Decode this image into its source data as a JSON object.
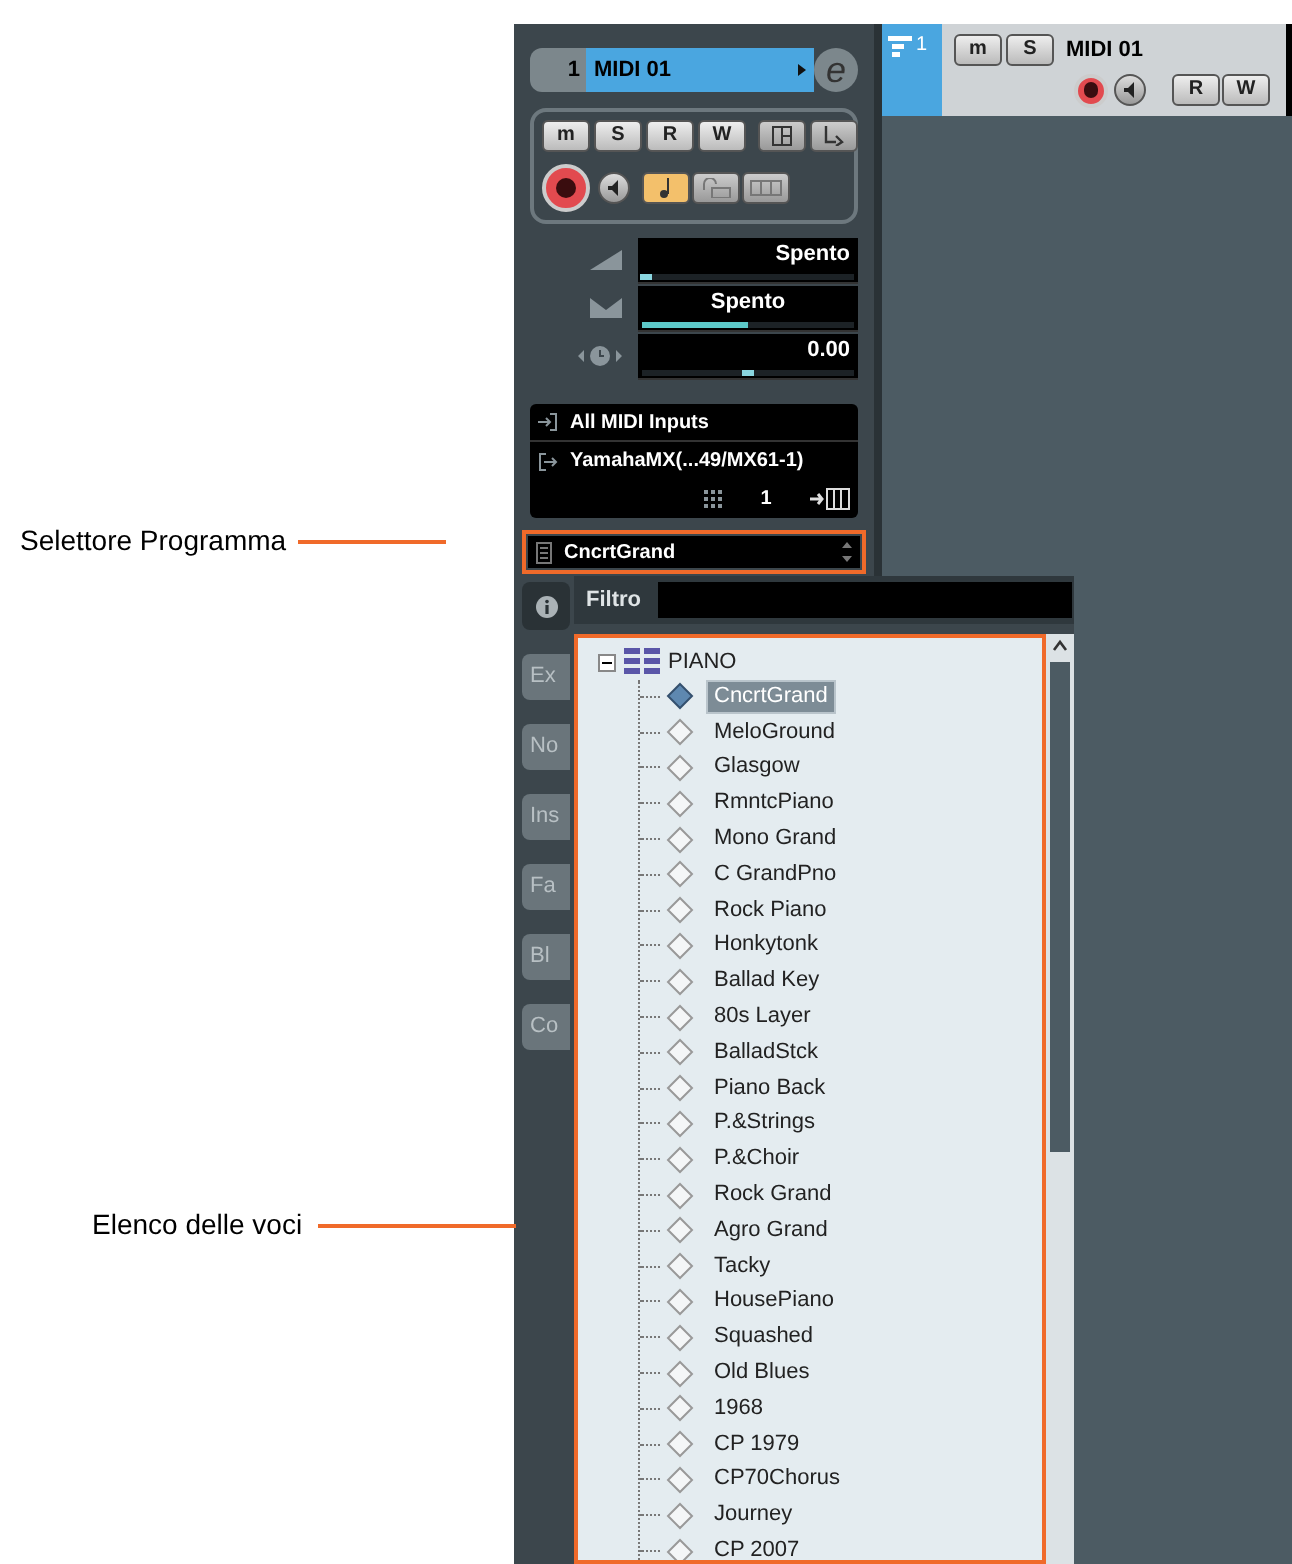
{
  "callouts": [
    {
      "label": "Selettore Programma"
    },
    {
      "label": "Elenco delle voci"
    }
  ],
  "inspector": {
    "track_number": "1",
    "track_name": "MIDI 01",
    "edit_glyph": "e",
    "buttons": [
      {
        "label": "m",
        "kind": "text",
        "on": false
      },
      {
        "label": "S",
        "kind": "text",
        "on": false
      },
      {
        "label": "R",
        "kind": "text",
        "on": false
      },
      {
        "label": "W",
        "kind": "text",
        "on": false
      },
      {
        "kind": "layout",
        "on": false
      },
      {
        "kind": "output",
        "on": false
      }
    ],
    "toggles": [
      {
        "kind": "note",
        "on": true
      },
      {
        "kind": "lock",
        "on": false
      },
      {
        "kind": "grid",
        "on": false
      }
    ],
    "record_armed": true,
    "faders": [
      {
        "kind": "marker",
        "reading": "Spento",
        "level": 0.02
      },
      {
        "kind": "fill",
        "reading": "Spento",
        "level": 0.5
      },
      {
        "kind": "marker",
        "reading": "0.00",
        "level": 0.5
      }
    ],
    "input": "All MIDI Inputs",
    "output": "YamahaMX(...49/MX61-1)",
    "channel": "1",
    "side_tabs": [
      "Ex",
      "No",
      "Ins",
      "Fa",
      "Bl",
      "Co"
    ]
  },
  "program_selector": {
    "value": "CncrtGrand"
  },
  "filter": {
    "label": "Filtro"
  },
  "preset_tree": {
    "category": "PIANO",
    "expanded": true,
    "items": [
      {
        "name": "CncrtGrand",
        "selected": true
      },
      {
        "name": "MeloGround",
        "selected": false
      },
      {
        "name": "Glasgow",
        "selected": false
      },
      {
        "name": "RmntcPiano",
        "selected": false
      },
      {
        "name": "Mono Grand",
        "selected": false
      },
      {
        "name": "C GrandPno",
        "selected": false
      },
      {
        "name": "Rock Piano",
        "selected": false
      },
      {
        "name": "Honkytonk",
        "selected": false
      },
      {
        "name": "Ballad Key",
        "selected": false
      },
      {
        "name": "80s Layer",
        "selected": false
      },
      {
        "name": "BalladStck",
        "selected": false
      },
      {
        "name": "Piano Back",
        "selected": false
      },
      {
        "name": "P.&Strings",
        "selected": false
      },
      {
        "name": "P.&Choir",
        "selected": false
      },
      {
        "name": "Rock Grand",
        "selected": false
      },
      {
        "name": "Agro Grand",
        "selected": false
      },
      {
        "name": "Tacky",
        "selected": false
      },
      {
        "name": "HousePiano",
        "selected": false
      },
      {
        "name": "Squashed",
        "selected": false
      },
      {
        "name": "Old Blues",
        "selected": false
      },
      {
        "name": "1968",
        "selected": false
      },
      {
        "name": "CP 1979",
        "selected": false
      },
      {
        "name": "CP70Chorus",
        "selected": false
      },
      {
        "name": "Journey",
        "selected": false
      },
      {
        "name": "CP 2007",
        "selected": false
      }
    ]
  },
  "track_header": {
    "number": "1",
    "name": "MIDI 01",
    "buttons": [
      {
        "label": "m",
        "on": false
      },
      {
        "label": "S",
        "on": false
      }
    ],
    "rw": [
      {
        "label": "R",
        "on": false
      },
      {
        "label": "W",
        "on": false
      }
    ],
    "record_armed": true
  }
}
